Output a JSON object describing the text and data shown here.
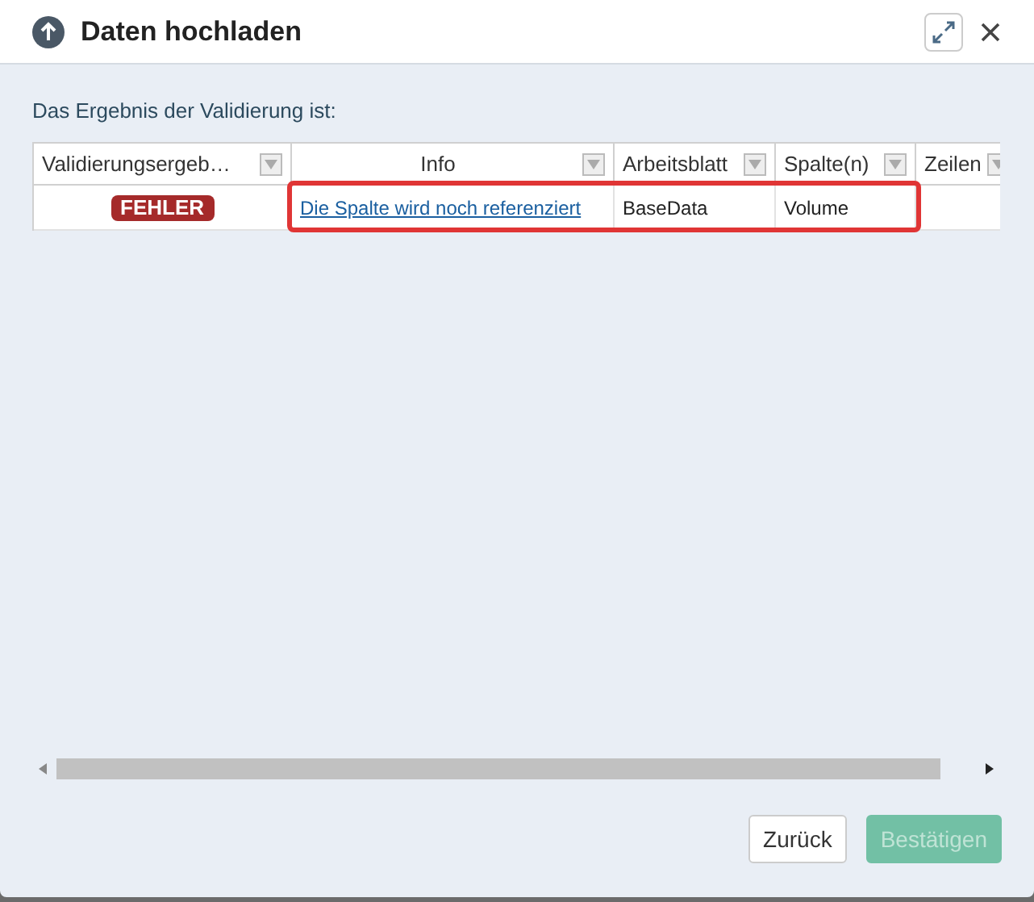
{
  "dialog": {
    "title": "Daten hochladen"
  },
  "intro": "Das Ergebnis der Validierung ist:",
  "table": {
    "columns": [
      {
        "label": "Validierungsergeb…"
      },
      {
        "label": "Info"
      },
      {
        "label": "Arbeitsblatt"
      },
      {
        "label": "Spalte(n)"
      },
      {
        "label": "Zeilen"
      }
    ],
    "rows": [
      {
        "status": "FEHLER",
        "info": "Die Spalte wird noch referenziert",
        "sheet": "BaseData",
        "column": "Volume",
        "highlighted": true
      }
    ]
  },
  "buttons": [
    {
      "label": "Zurück",
      "kind": "secondary",
      "disabled": false
    },
    {
      "label": "Bestätigen",
      "kind": "primary",
      "disabled": true
    }
  ]
}
